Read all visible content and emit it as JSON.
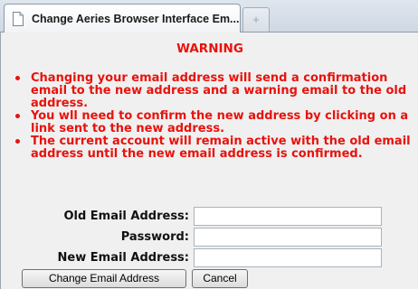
{
  "browser": {
    "tab_title": "Change Aeries Browser Interface Em...",
    "new_tab_glyph": "+"
  },
  "page": {
    "warning_title": "WARNING",
    "bullets": [
      "Changing your email address will send a confirmation email to the new address and a warning email to the old address.",
      "You wll need to confirm the new address by clicking on a link sent to the new address.",
      "The current account will remain active with the old email address until the new email address is confirmed."
    ],
    "form": {
      "old_email_label": "Old Email Address:",
      "old_email_value": "",
      "password_label": "Password:",
      "password_value": "",
      "new_email_label": "New Email Address:",
      "new_email_value": ""
    },
    "buttons": {
      "change": "Change Email Address",
      "cancel": "Cancel"
    }
  },
  "colors": {
    "warning_red": "#e8120c",
    "page_background": "#f0f0f0"
  }
}
